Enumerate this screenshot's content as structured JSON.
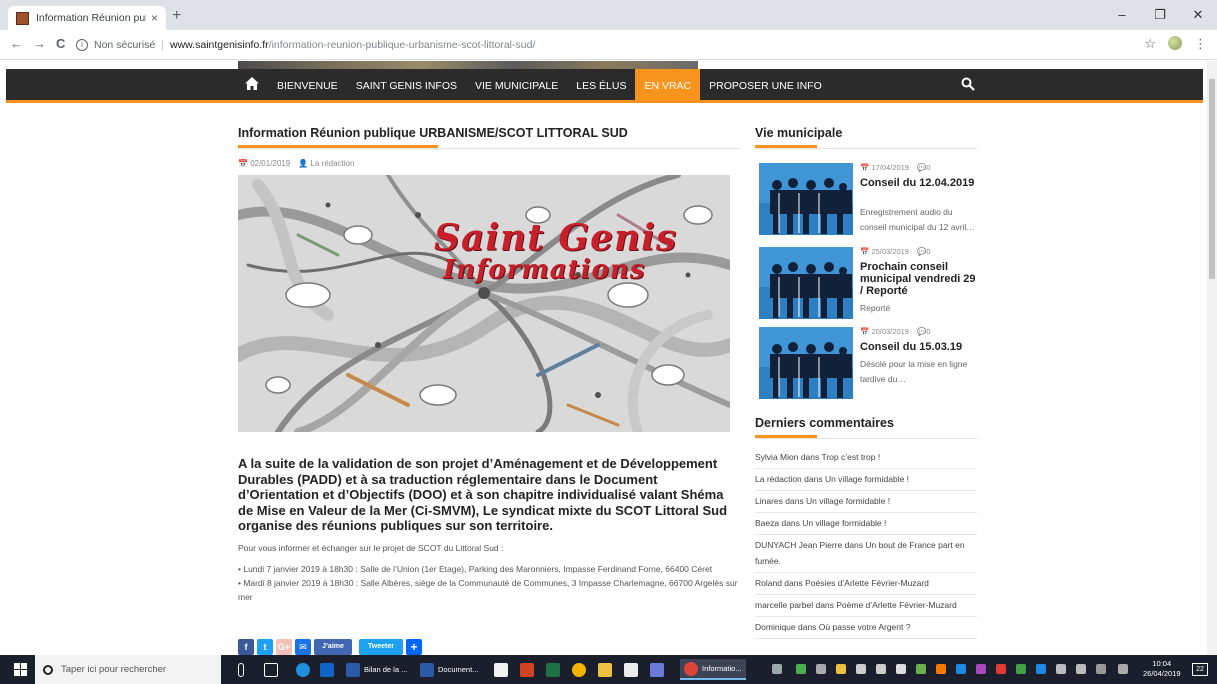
{
  "browser": {
    "tab_title": "Information Réunion publique URBANISME/SCOT LITTORAL SUD – Saint Genis Info",
    "new_tab_glyph": "+",
    "close_tab_glyph": "×",
    "security_label": "Non sécurisé",
    "url_host": "www.saintgenisinfo.fr",
    "url_path": "/information-reunion-publique-urbanisme-scot-littoral-sud/",
    "win_minimize": "–",
    "win_restore": "❐",
    "win_close": "✕",
    "back": "←",
    "forward": "→",
    "reload": "C",
    "star": "☆",
    "menu": "⋮"
  },
  "nav": {
    "home_icon": "home-icon",
    "items": [
      {
        "label": "BIENVENUE",
        "active": false
      },
      {
        "label": "SAINT GENIS INFOS",
        "active": false
      },
      {
        "label": "VIE MUNICIPALE",
        "active": false
      },
      {
        "label": "LES ÉLUS",
        "active": false
      },
      {
        "label": "EN VRAC",
        "active": true
      },
      {
        "label": "PROPOSER UNE INFO",
        "active": false
      }
    ],
    "accent_color": "#f7941d",
    "bar_color": "#2b2b2b"
  },
  "article": {
    "title": "Information Réunion publique URBANISME/SCOT LITTORAL SUD",
    "date": "02/01/2019",
    "author": "La rédaction",
    "hero_line1": "Saint Genis",
    "hero_line2": "Informations",
    "lead": "A la suite de la validation de son projet d’Aménagement et de Développement Durables (PADD) et à sa traduction réglementaire dans le Document d’Orientation et d’Objectifs (DOO) et à son chapitre individualisé valant Shéma de Mise en Valeur de la Mer (Ci-SMVM), Le syndicat mixte du SCOT Littoral Sud organise des réunions publiques sur son territoire.",
    "intro": "Pour vous informer et échanger sur le projet de SCOT du Littoral Sud :",
    "meeting1": "• Lundi 7 janvier 2019 à 18h30 : Salle de l’Union (1er Etage), Parking des Maronniers, Impasse Ferdinand Forne, 66400 Céret",
    "meeting2": "• Mardi 8 janvier 2019 à 18h30 : Salle Albères, siège de la Communauté de Communes, 3 Impasse Charlemagne, 66700 Argelès sur mer"
  },
  "share": {
    "facebook": "f",
    "twitter": "t",
    "gplus": "G+",
    "email": "✉",
    "like": "J’aime",
    "tweet": "Tweeter",
    "more": "+"
  },
  "sidebar": {
    "vie_title": "Vie municipale",
    "posts": [
      {
        "date": "17/04/2019",
        "comments": "0",
        "title": "Conseil du 12.04.2019",
        "excerpt": "Enregistrement audio du conseil municipal du 12 avril…"
      },
      {
        "date": "25/03/2019",
        "comments": "0",
        "title": "Prochain conseil municipal vendredi 29 / Reporté",
        "excerpt": "Reporté"
      },
      {
        "date": "20/03/2019",
        "comments": "0",
        "title": "Conseil du 15.03.19",
        "excerpt": "Désolé pour la mise en ligne tardive du…"
      }
    ],
    "comments_title": "Derniers commentaires",
    "comments": [
      "Sylvia Mion dans Trop c’est trop !",
      "La rédaction dans Un village formidable !",
      "Linares dans Un village formidable !",
      "Baeza dans Un village formidable !",
      "DUNYACH Jean Pierre dans Un bout de France part en fumée.",
      "Roland dans Poésies d’Arlette Février-Muzard",
      "marcelle parbel dans Poème d’Arlette Février-Muzard",
      "Dominique dans Où passe votre Argent ?"
    ]
  },
  "taskbar": {
    "search_placeholder": "Taper ici pour rechercher",
    "word1": "Bilan de la ...",
    "word2": "Document...",
    "chrome": "Informatio...",
    "time": "10:04",
    "date": "26/04/2019",
    "notif_count": "22"
  }
}
